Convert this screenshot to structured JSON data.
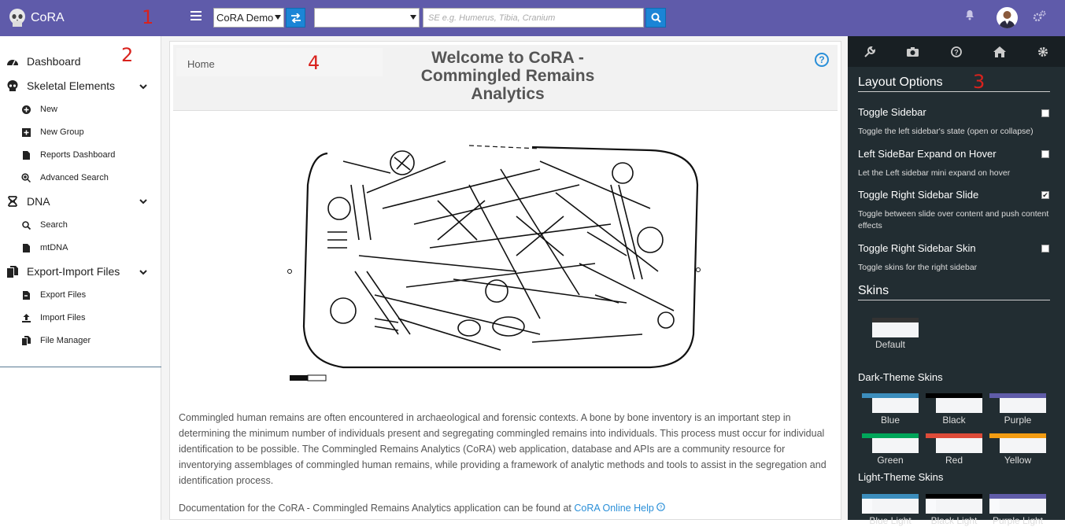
{
  "header": {
    "app_name": "CoRA",
    "project_select": "CoRA Demo",
    "search_placeholder": "SE e.g. Humerus, Tibia, Cranium",
    "annotation_1": "1"
  },
  "sidebar": {
    "annotation": "2",
    "items": [
      {
        "label": "Dashboard",
        "icon": "dashboard-icon"
      },
      {
        "label": "Skeletal Elements",
        "icon": "skull-icon"
      },
      {
        "label": "New",
        "icon": "plus-circle-icon"
      },
      {
        "label": "New Group",
        "icon": "plus-square-icon"
      },
      {
        "label": "Reports Dashboard",
        "icon": "file-icon"
      },
      {
        "label": "Advanced Search",
        "icon": "search-plus-icon"
      },
      {
        "label": "DNA",
        "icon": "dna-icon"
      },
      {
        "label": "Search",
        "icon": "search-icon"
      },
      {
        "label": "mtDNA",
        "icon": "file-icon"
      },
      {
        "label": "Export-Import Files",
        "icon": "files-icon"
      },
      {
        "label": "Export Files",
        "icon": "file-export-icon"
      },
      {
        "label": "Import Files",
        "icon": "upload-icon"
      },
      {
        "label": "File Manager",
        "icon": "files-icon"
      }
    ]
  },
  "main": {
    "annotation": "4",
    "breadcrumb": "Home",
    "title_line1": "Welcome to CoRA -",
    "title_line2": "Commingled Remains",
    "title_line3": "Analytics",
    "help": "?",
    "paragraph": "Commingled human remains are often encountered in archaeological and forensic contexts. A bone by bone inventory is an important step in determining the minimum number of individuals present and segregating commingled remains into individuals. This process must occur for individual identification to be possible. The Commingled Remains Analytics (CoRA) web application, database and APIs are a community resource for inventorying assemblages of commingled human remains, while providing a framework of analytic methods and tools to assist in the segregation and identification process.",
    "doc_text": "Documentation for the CoRA - Commingled Remains Analytics application can be found at",
    "doc_link": "CoRA Online Help"
  },
  "right_sidebar": {
    "annotation": "3",
    "layout_title": "Layout Options",
    "options": [
      {
        "title": "Toggle Sidebar",
        "desc": "Toggle the left sidebar's state (open or collapse)",
        "checked": false
      },
      {
        "title": "Left SideBar Expand on Hover",
        "desc": "Let the Left sidebar mini expand on hover",
        "checked": false
      },
      {
        "title": "Toggle Right Sidebar Slide",
        "desc": "Toggle between slide over content and push content effects",
        "checked": true
      },
      {
        "title": "Toggle Right Sidebar Skin",
        "desc": "Toggle skins for the right sidebar",
        "checked": false
      }
    ],
    "skins_title": "Skins",
    "default_label": "Default",
    "dark_title": "Dark-Theme Skins",
    "dark_skins": [
      {
        "label": "Blue",
        "color": "#3c8dbc"
      },
      {
        "label": "Black",
        "color": "#000000"
      },
      {
        "label": "Purple",
        "color": "#605ca8"
      },
      {
        "label": "Green",
        "color": "#00a65a"
      },
      {
        "label": "Red",
        "color": "#dd4b39"
      },
      {
        "label": "Yellow",
        "color": "#f39c12"
      }
    ],
    "light_title": "Light-Theme Skins",
    "light_skins": [
      {
        "label": "Blue Light",
        "color": "#3c8dbc"
      },
      {
        "label": "Black Light",
        "color": "#000000"
      },
      {
        "label": "Purple Light",
        "color": "#605ca8"
      }
    ]
  },
  "colors": {
    "header": "#5f5baa",
    "accent": "#1b85d6",
    "right_sidebar": "#222d32"
  }
}
